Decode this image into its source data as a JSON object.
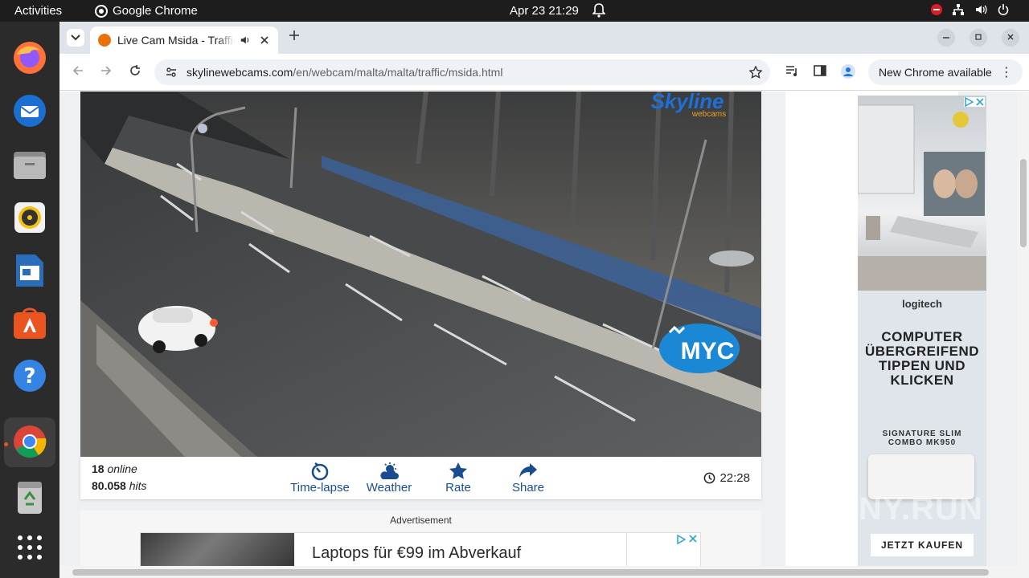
{
  "topbar": {
    "activities": "Activities",
    "app_name": "Google Chrome",
    "clock": "Apr 23  21:29"
  },
  "dock": {
    "items": [
      "firefox-icon",
      "thunderbird-icon",
      "files-icon",
      "rhythmbox-icon",
      "libreoffice-writer-icon",
      "app-center-icon",
      "help-icon",
      "chrome-icon",
      "trash-icon",
      "show-apps-icon"
    ]
  },
  "browser": {
    "tab_title": "Live Cam Msida - Traffic",
    "url_domain": "skylinewebcams.com",
    "url_path": "/en/webcam/malta/malta/traffic/msida.html",
    "update_label": "New Chrome available"
  },
  "cam": {
    "logo_main": "Skyline",
    "logo_sub": "webcams",
    "overlay_logo": "MYC",
    "online_count": "18",
    "online_label": "online",
    "hits_count": "80.058",
    "hits_label": "hits",
    "actions": [
      "Time-lapse",
      "Weather",
      "Rate",
      "Share"
    ],
    "local_time": "22:28"
  },
  "ad_bottom": {
    "label": "Advertisement",
    "headline": "Laptops für €99 im Abverkauf"
  },
  "ad_side": {
    "brand": "logitech",
    "headline": "COMPUTER ÜBERGREIFEND TIPPEN UND KLICKEN",
    "product": "SIGNATURE SLIM COMBO MK950",
    "cta": "JETZT KAUFEN"
  },
  "watermark": "ANY.RUN",
  "colors": {
    "accent_blue": "#1a4d8f",
    "ubuntu_orange": "#e95420",
    "topbar_bg": "#1d1d1d"
  }
}
